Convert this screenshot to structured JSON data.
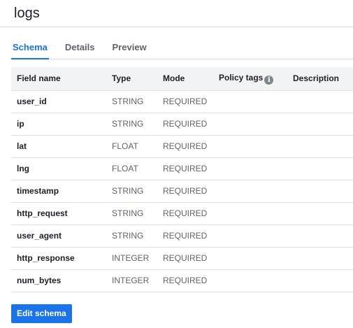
{
  "page": {
    "title": "logs"
  },
  "tabs": [
    {
      "label": "Schema",
      "active": true
    },
    {
      "label": "Details",
      "active": false
    },
    {
      "label": "Preview",
      "active": false
    }
  ],
  "table": {
    "headers": {
      "field_name": "Field name",
      "type": "Type",
      "mode": "Mode",
      "policy_tags": "Policy tags",
      "description": "Description"
    },
    "info_icon": "info-icon",
    "rows": [
      {
        "name": "user_id",
        "type": "STRING",
        "mode": "REQUIRED"
      },
      {
        "name": "ip",
        "type": "STRING",
        "mode": "REQUIRED"
      },
      {
        "name": "lat",
        "type": "FLOAT",
        "mode": "REQUIRED"
      },
      {
        "name": "lng",
        "type": "FLOAT",
        "mode": "REQUIRED"
      },
      {
        "name": "timestamp",
        "type": "STRING",
        "mode": "REQUIRED"
      },
      {
        "name": "http_request",
        "type": "STRING",
        "mode": "REQUIRED"
      },
      {
        "name": "user_agent",
        "type": "STRING",
        "mode": "REQUIRED"
      },
      {
        "name": "http_response",
        "type": "INTEGER",
        "mode": "REQUIRED"
      },
      {
        "name": "num_bytes",
        "type": "INTEGER",
        "mode": "REQUIRED"
      }
    ]
  },
  "actions": {
    "edit_schema_label": "Edit schema"
  },
  "colors": {
    "accent": "#1a73e8",
    "header_bg": "#f1f3f4",
    "divider": "#dadce0"
  }
}
